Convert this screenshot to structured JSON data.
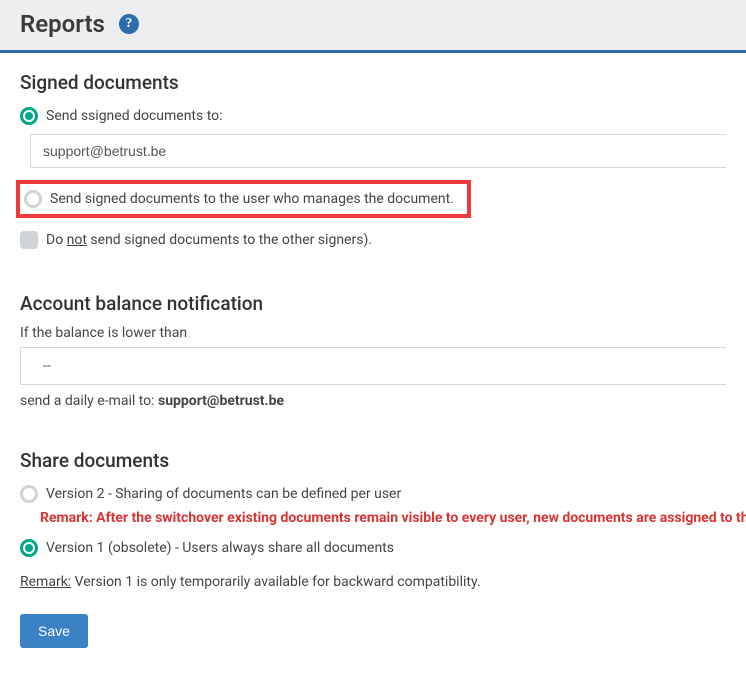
{
  "header": {
    "title": "Reports"
  },
  "signed": {
    "heading": "Signed documents",
    "opt_send_to_label": "Send ssigned documents to:",
    "email_value": "support@betrust.be",
    "opt_send_to_manager": "Send signed documents to the user who manages the document.",
    "opt_do_not_prefix": "Do ",
    "opt_do_not_word": "not",
    "opt_do_not_suffix": " send signed documents to the other signers)."
  },
  "balance": {
    "heading": "Account balance notification",
    "if_lower": "If the balance is lower than",
    "select_value": "--",
    "send_prefix": "send a daily e-mail to: ",
    "send_email": "support@betrust.be"
  },
  "share": {
    "heading": "Share documents",
    "v2_label": "Version 2 - Sharing of documents can be defined per user",
    "remark_red": "Remark: After the switchover existing documents remain visible to every user, new documents are assigned to the",
    "v1_label": "Version 1 (obsolete) - Users always share all documents",
    "remark_prefix": "Remark:",
    "remark_body": " Version 1 is only temporarily available for backward compatibility."
  },
  "actions": {
    "save": "Save"
  }
}
